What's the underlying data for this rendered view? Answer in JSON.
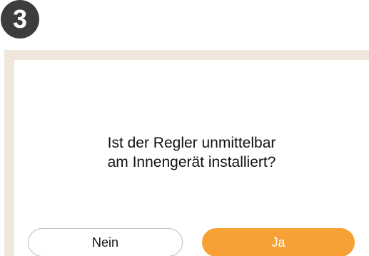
{
  "step": {
    "number": "3"
  },
  "dialog": {
    "question_line1": "Ist der Regler unmittelbar",
    "question_line2": "am Innengerät installiert?",
    "no_label": "Nein",
    "yes_label": "Ja"
  },
  "colors": {
    "badge_bg": "#3d3d3d",
    "panel_border": "#efe7db",
    "yes_button": "#f7a033",
    "no_button_border": "#bdbdbd"
  }
}
